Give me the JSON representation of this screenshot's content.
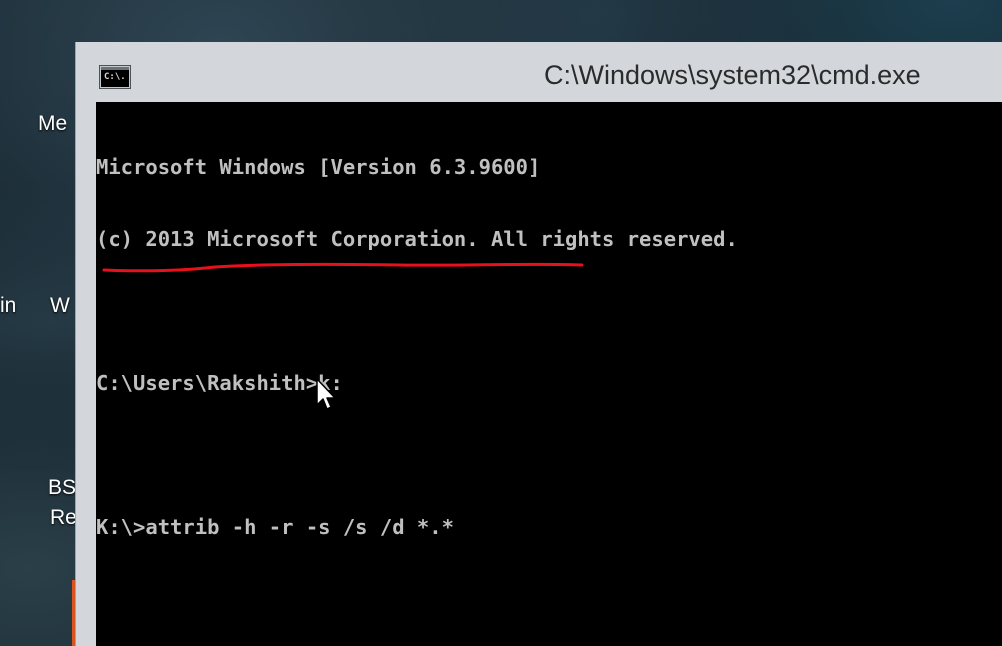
{
  "desktop": {
    "icon_labels": [
      "Me",
      "in",
      "W",
      "BS",
      "Re"
    ]
  },
  "window": {
    "title": "C:\\Windows\\system32\\cmd.exe",
    "icon_text": "C:\\."
  },
  "console": {
    "lines": [
      "Microsoft Windows [Version 6.3.9600]",
      "(c) 2013 Microsoft Corporation. All rights reserved.",
      "",
      "C:\\Users\\Rakshith>k:",
      "",
      "K:\\>attrib -h -r -s /s /d *.*"
    ]
  },
  "annotation": {
    "underline_color": "#e8101a"
  }
}
